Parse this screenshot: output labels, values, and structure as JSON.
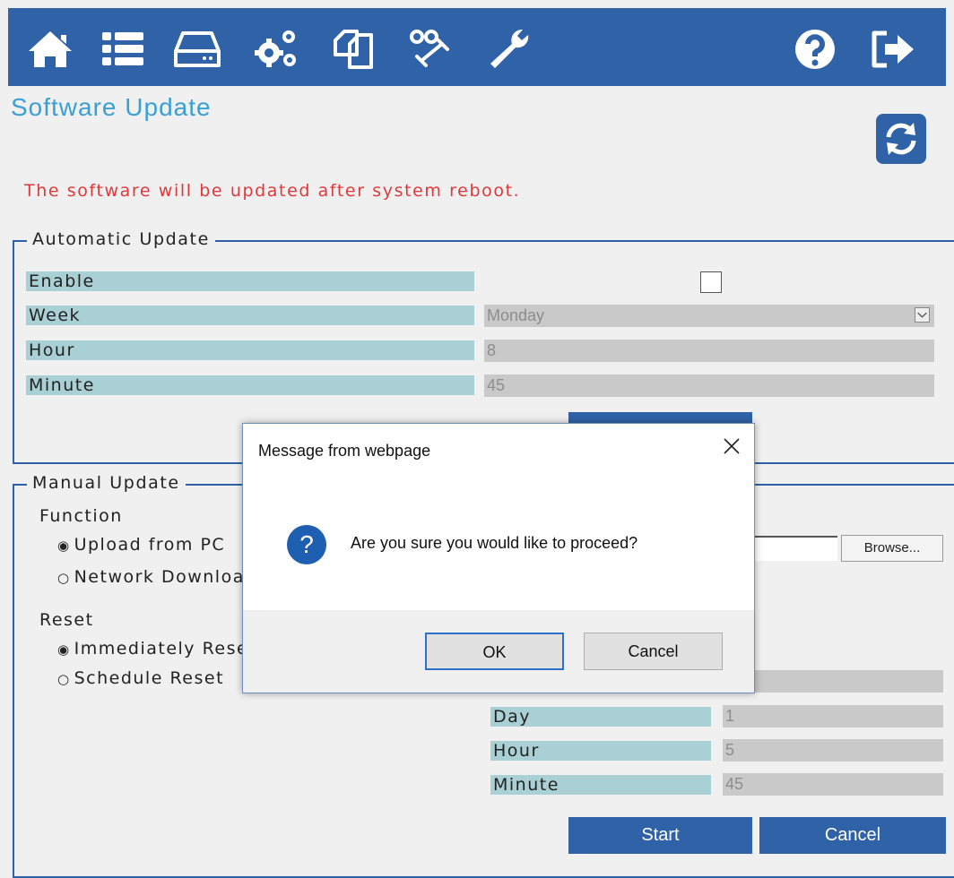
{
  "toolbar": {
    "icons": [
      "home-icon",
      "list-icon",
      "storage-icon",
      "settings-icon",
      "copy-icon",
      "tools-icon",
      "wrench-icon",
      "help-icon",
      "logout-icon"
    ]
  },
  "page": {
    "title": "Software Update",
    "notice": "The software will be updated after system reboot."
  },
  "auto_update": {
    "legend": "Automatic Update",
    "enable_label": "Enable",
    "enable_checked": false,
    "week_label": "Week",
    "week_value": "Monday",
    "hour_label": "Hour",
    "hour_value": "8",
    "minute_label": "Minute",
    "minute_value": "45"
  },
  "manual_update": {
    "legend": "Manual Update",
    "function_label": "Function",
    "upload_option": "Upload from PC",
    "network_option": "Network Download",
    "browse_label": "Browse...",
    "reset_label": "Reset",
    "immediate_option": "Immediately Reset",
    "schedule_option": "Schedule Reset",
    "day_label": "Day",
    "day_value": "1",
    "hour_label": "Hour",
    "hour_value": "5",
    "minute_label": "Minute",
    "minute_value": "45",
    "start_label": "Start",
    "cancel_label": "Cancel"
  },
  "dialog": {
    "title": "Message from webpage",
    "message": "Are you sure you would like to proceed?",
    "ok_label": "OK",
    "cancel_label": "Cancel"
  },
  "colors": {
    "accent": "#2f62a7",
    "title": "#3aa0d3",
    "warning": "#e0393c",
    "label_bg": "#a9d0d5",
    "value_bg": "#c9c9c9"
  }
}
